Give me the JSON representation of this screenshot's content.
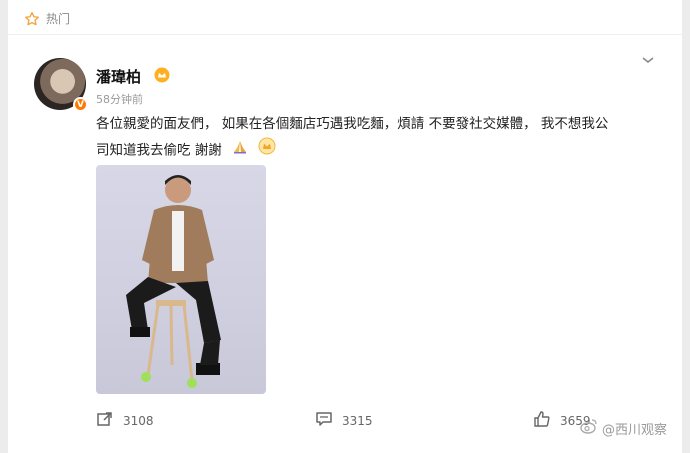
{
  "section": {
    "label": "热门",
    "icon": "star-outline-icon"
  },
  "post": {
    "author": "潘瑋柏",
    "time": "58分钟前",
    "lines": [
      "各位親愛的面友們， 如果在各個麵店巧遇我吃麵，煩請 不要發社交媒體， 我不想我公",
      "司知道我去偷吃 謝謝"
    ],
    "emojis": [
      "pray-icon",
      "crown-emoji-icon"
    ]
  },
  "actions": {
    "repost_count": "3108",
    "comment_count": "3315",
    "like_count": "3659"
  },
  "watermark": {
    "text": "@西川观察"
  },
  "colors": {
    "vip_orange": "#ff7a00",
    "background": "#ececec",
    "card": "#ffffff"
  }
}
